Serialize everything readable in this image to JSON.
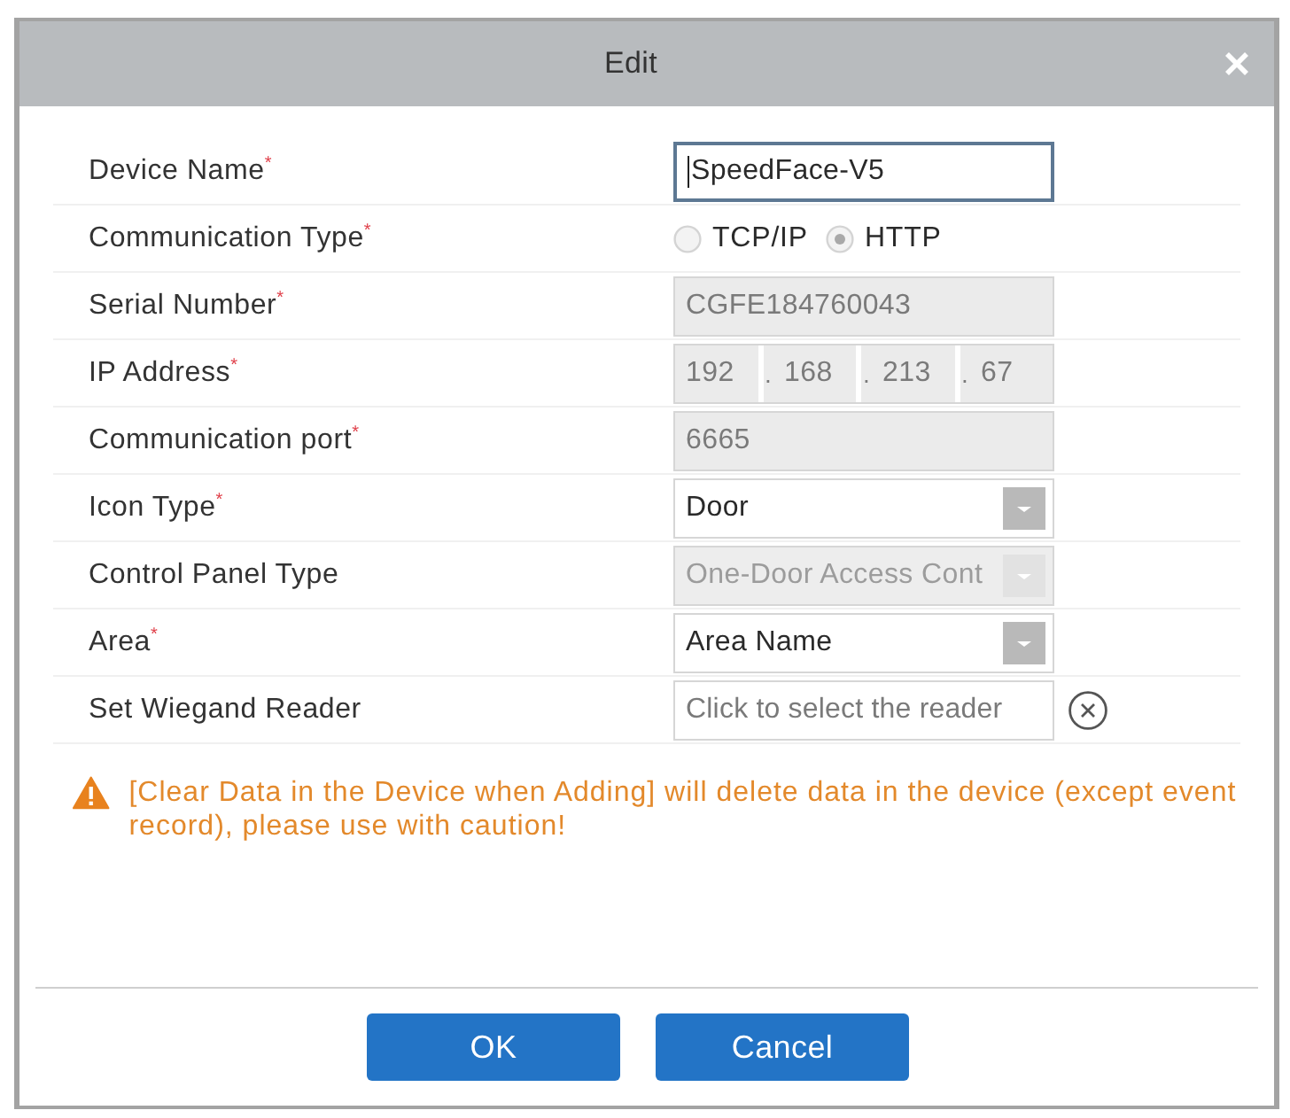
{
  "dialog": {
    "title": "Edit"
  },
  "form": {
    "rows": [
      {
        "label": "Device Name$^{*}$",
        "kind": "text",
        "value": "SpeedFace-V5",
        "disabled": false,
        "focused": true
      },
      {
        "label": "Communication Type$^{*}$",
        "kind": "radio",
        "options": [
          {
            "label": "TCP/IP",
            "selected": false
          },
          {
            "label": "HTTP",
            "selected": true
          }
        ]
      },
      {
        "label": "Serial Number$^{*}$",
        "kind": "text",
        "value": "CGFE184760043",
        "disabled": true,
        "focused": false
      },
      {
        "label": "IP Address$^{*}$",
        "kind": "ip",
        "octets": [
          "192",
          "168",
          "213",
          "67"
        ],
        "separator": ".",
        "disabled": true
      },
      {
        "label": "Communication port$^{*}$",
        "kind": "text",
        "value": "6665",
        "disabled": true,
        "focused": false
      },
      {
        "label": "Icon Type$^{*}$",
        "kind": "select",
        "value": "Door",
        "disabled": false
      },
      {
        "label": "Control Panel Type",
        "kind": "select",
        "value": "One-Door Access Cont",
        "disabled": true
      },
      {
        "label": "Area$^{*}$",
        "kind": "select",
        "value": "Area Name",
        "disabled": false
      },
      {
        "label": "Set Wiegand Reader",
        "kind": "picker",
        "placeholder": "Click to select the reader"
      }
    ]
  },
  "warning": {
    "text": "[Clear Data in the Device when Adding] will delete data in the device (except event record), please use with caution!"
  },
  "buttons": [
    {
      "label": "OK"
    },
    {
      "label": "Cancel"
    }
  ]
}
